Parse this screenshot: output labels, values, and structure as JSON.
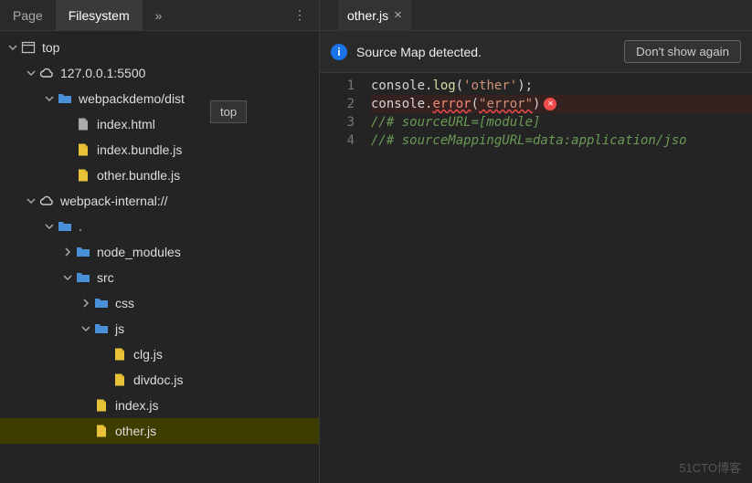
{
  "sidebar": {
    "tabs": {
      "page": "Page",
      "filesystem": "Filesystem",
      "overflow": "»"
    },
    "tooltip": "top",
    "tree": [
      {
        "id": "top",
        "label": "top",
        "depth": 0,
        "icon": "window",
        "arrow": "down"
      },
      {
        "id": "host",
        "label": "127.0.0.1:5500",
        "depth": 1,
        "icon": "cloud",
        "arrow": "down"
      },
      {
        "id": "dist",
        "label": "webpackdemo/dist",
        "depth": 2,
        "icon": "folder",
        "arrow": "down"
      },
      {
        "id": "indexhtml",
        "label": "index.html",
        "depth": 3,
        "icon": "file-grey",
        "arrow": "none"
      },
      {
        "id": "indexbundle",
        "label": "index.bundle.js",
        "depth": 3,
        "icon": "file-js",
        "arrow": "none"
      },
      {
        "id": "otherbundle",
        "label": "other.bundle.js",
        "depth": 3,
        "icon": "file-js",
        "arrow": "none"
      },
      {
        "id": "wpi",
        "label": "webpack-internal://",
        "depth": 1,
        "icon": "cloud",
        "arrow": "down"
      },
      {
        "id": "dot",
        "label": ".",
        "depth": 2,
        "icon": "folder",
        "arrow": "down"
      },
      {
        "id": "nodemod",
        "label": "node_modules",
        "depth": 3,
        "icon": "folder",
        "arrow": "right"
      },
      {
        "id": "src",
        "label": "src",
        "depth": 3,
        "icon": "folder",
        "arrow": "down"
      },
      {
        "id": "css",
        "label": "css",
        "depth": 4,
        "icon": "folder",
        "arrow": "right"
      },
      {
        "id": "js",
        "label": "js",
        "depth": 4,
        "icon": "folder",
        "arrow": "down"
      },
      {
        "id": "clg",
        "label": "clg.js",
        "depth": 5,
        "icon": "file-js",
        "arrow": "none"
      },
      {
        "id": "divdoc",
        "label": "divdoc.js",
        "depth": 5,
        "icon": "file-js",
        "arrow": "none"
      },
      {
        "id": "indexjs",
        "label": "index.js",
        "depth": 4,
        "icon": "file-js",
        "arrow": "none"
      },
      {
        "id": "otherjs",
        "label": "other.js",
        "depth": 4,
        "icon": "file-js",
        "arrow": "none",
        "selected": true
      }
    ]
  },
  "main": {
    "tab": {
      "name": "other.js"
    },
    "infobar": {
      "message": "Source Map detected.",
      "button": "Don't show again"
    },
    "code": {
      "lines": [
        "1",
        "2",
        "3",
        "4"
      ],
      "l1": {
        "a": "console.",
        "b": "log",
        "c": "(",
        "d": "'other'",
        "e": ");"
      },
      "l2": {
        "a": "console.",
        "b": "error",
        "c": "(",
        "d": "\"error\"",
        "e": ")"
      },
      "l3": "//# sourceURL=[module]",
      "l4": "//# sourceMappingURL=data:application/jso"
    }
  },
  "watermark": "51CTO博客"
}
